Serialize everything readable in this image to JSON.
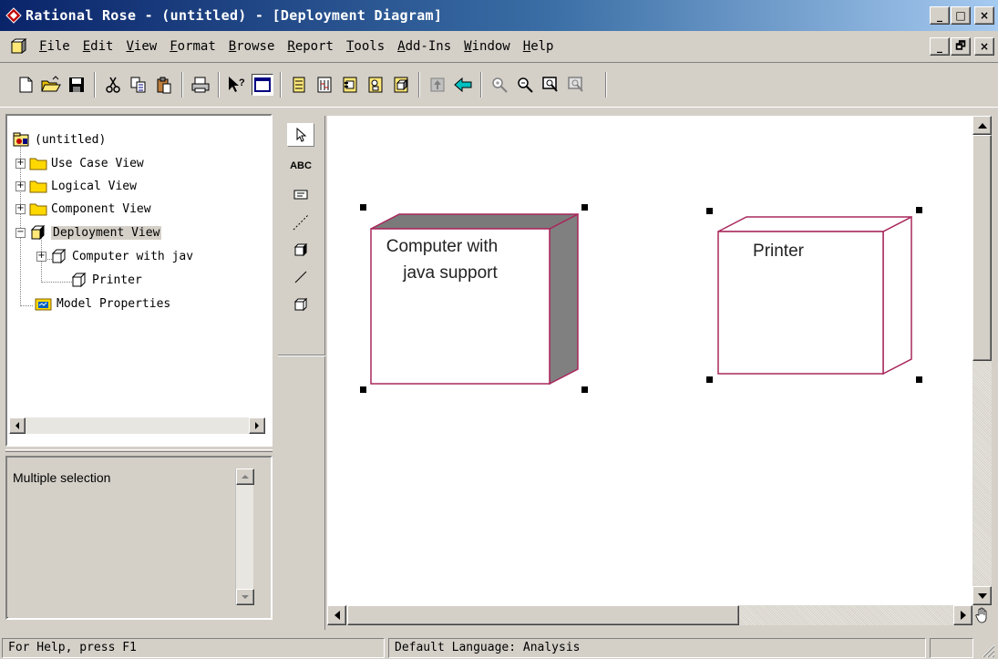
{
  "window": {
    "title": "Rational Rose - (untitled) - [Deployment Diagram]",
    "caption_buttons": [
      "_",
      "□",
      "×"
    ],
    "mdi_buttons": [
      "_",
      "🗗",
      "×"
    ]
  },
  "menu": {
    "items": [
      {
        "key": "F",
        "rest": "ile"
      },
      {
        "key": "E",
        "rest": "dit"
      },
      {
        "key": "V",
        "rest": "iew"
      },
      {
        "key": "F",
        "rest": "ormat"
      },
      {
        "key": "B",
        "rest": "rowse"
      },
      {
        "key": "R",
        "rest": "eport"
      },
      {
        "key": "T",
        "rest": "ools"
      },
      {
        "key": "A",
        "rest": "dd-Ins"
      },
      {
        "key": "W",
        "rest": "indow"
      },
      {
        "key": "H",
        "rest": "elp"
      }
    ]
  },
  "toolbar": {
    "buttons": [
      "new-icon",
      "open-icon",
      "save-icon",
      "|",
      "cut-icon",
      "copy-icon",
      "paste-icon",
      "|",
      "print-icon",
      "|",
      "context-help-icon",
      "view-doc-icon",
      "|",
      "browse-class-icon",
      "browse-interaction-icon",
      "browse-component-icon",
      "browse-deployment-icon",
      "browse-node-icon",
      "|",
      "browse-parent-icon",
      "browse-previous-icon",
      "|",
      "zoom-in-icon",
      "zoom-out-icon",
      "fit-window-icon",
      "undo-fit-icon"
    ]
  },
  "browser": {
    "root": "(untitled)",
    "items": [
      {
        "label": "Use Case View",
        "expander": "+",
        "icon": "folder-icon"
      },
      {
        "label": "Logical View",
        "expander": "+",
        "icon": "folder-icon"
      },
      {
        "label": "Component View",
        "expander": "+",
        "icon": "folder-icon"
      },
      {
        "label": "Deployment View",
        "expander": "−",
        "icon": "deployment-view-icon",
        "selected": true
      }
    ],
    "children": [
      {
        "label": "Computer with jav",
        "expander": "+"
      },
      {
        "label": "Printer",
        "expander": ""
      }
    ],
    "model_properties": "Model Properties"
  },
  "documentation": {
    "text": "Multiple selection"
  },
  "palette": {
    "tools": [
      "selection-tool-icon",
      "text-box-tool",
      "note-tool-icon",
      "anchor-note-tool-icon",
      "processor-tool-icon",
      "connection-tool-icon",
      "device-tool-icon"
    ],
    "text_tool_label": "ABC"
  },
  "diagram": {
    "nodes": [
      {
        "name_line1": "Computer with",
        "name_line2": "java support",
        "kind": "processor"
      },
      {
        "name_line1": "Printer",
        "name_line2": "",
        "kind": "device"
      }
    ]
  },
  "status": {
    "help": "For Help, press F1",
    "language": "Default Language: Analysis"
  },
  "colors": {
    "node_border": "#a8285c",
    "processor_shade": "#808080",
    "title_start": "#0a246a",
    "title_end": "#a6caf0"
  }
}
